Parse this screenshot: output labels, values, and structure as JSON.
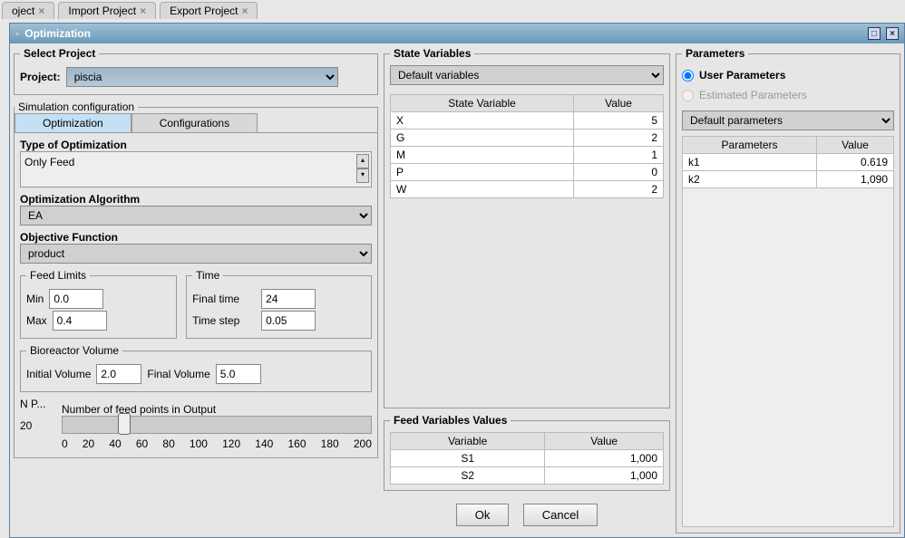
{
  "bgTabs": [
    "oject",
    "Import Project",
    "Export Project"
  ],
  "windowTitle": "Optimization",
  "selectProject": {
    "legend": "Select Project",
    "label": "Project:",
    "value": "piscia"
  },
  "simTabGroup": "Simulation configuration",
  "tabs": {
    "optimization": "Optimization",
    "configurations": "Configurations"
  },
  "typeOpt": {
    "label": "Type of Optimization",
    "value": "Only Feed"
  },
  "optAlg": {
    "label": "Optimization Algorithm",
    "value": "EA"
  },
  "objFunc": {
    "label": "Objective Function",
    "value": "product"
  },
  "feedLimits": {
    "legend": "Feed Limits",
    "minLabel": "Min",
    "minVal": "0.0",
    "maxLabel": "Max",
    "maxVal": "0.4"
  },
  "time": {
    "legend": "Time",
    "finalLabel": "Final time",
    "finalVal": "24",
    "stepLabel": "Time step",
    "stepVal": "0.05"
  },
  "bioreactor": {
    "legend": "Bioreactor Volume",
    "initLabel": "Initial Volume",
    "initVal": "2.0",
    "finalLabel": "Final Volume",
    "finalVal": "5.0"
  },
  "np": {
    "short": "N P...",
    "val": "20",
    "sliderLabel": "Number of feed points in Output",
    "ticks": [
      "0",
      "20",
      "40",
      "60",
      "80",
      "100",
      "120",
      "140",
      "160",
      "180",
      "200"
    ]
  },
  "stateVars": {
    "legend": "State Variables",
    "dropdown": "Default variables",
    "hdrVar": "State Variable",
    "hdrVal": "Value",
    "rows": [
      {
        "v": "X",
        "val": "5"
      },
      {
        "v": "G",
        "val": "2"
      },
      {
        "v": "M",
        "val": "1"
      },
      {
        "v": "P",
        "val": "0"
      },
      {
        "v": "W",
        "val": "2"
      }
    ]
  },
  "feedVars": {
    "legend": "Feed Variables Values",
    "hdrVar": "Variable",
    "hdrVal": "Value",
    "rows": [
      {
        "v": "S1",
        "val": "1,000"
      },
      {
        "v": "S2",
        "val": "1,000"
      }
    ]
  },
  "params": {
    "legend": "Parameters",
    "userLabel": "User Parameters",
    "estLabel": "Estimated Parameters",
    "dropdown": "Default parameters",
    "hdrP": "Parameters",
    "hdrV": "Value",
    "rows": [
      {
        "p": "k1",
        "v": "0.619"
      },
      {
        "p": "k2",
        "v": "1,090"
      }
    ]
  },
  "buttons": {
    "ok": "Ok",
    "cancel": "Cancel"
  }
}
